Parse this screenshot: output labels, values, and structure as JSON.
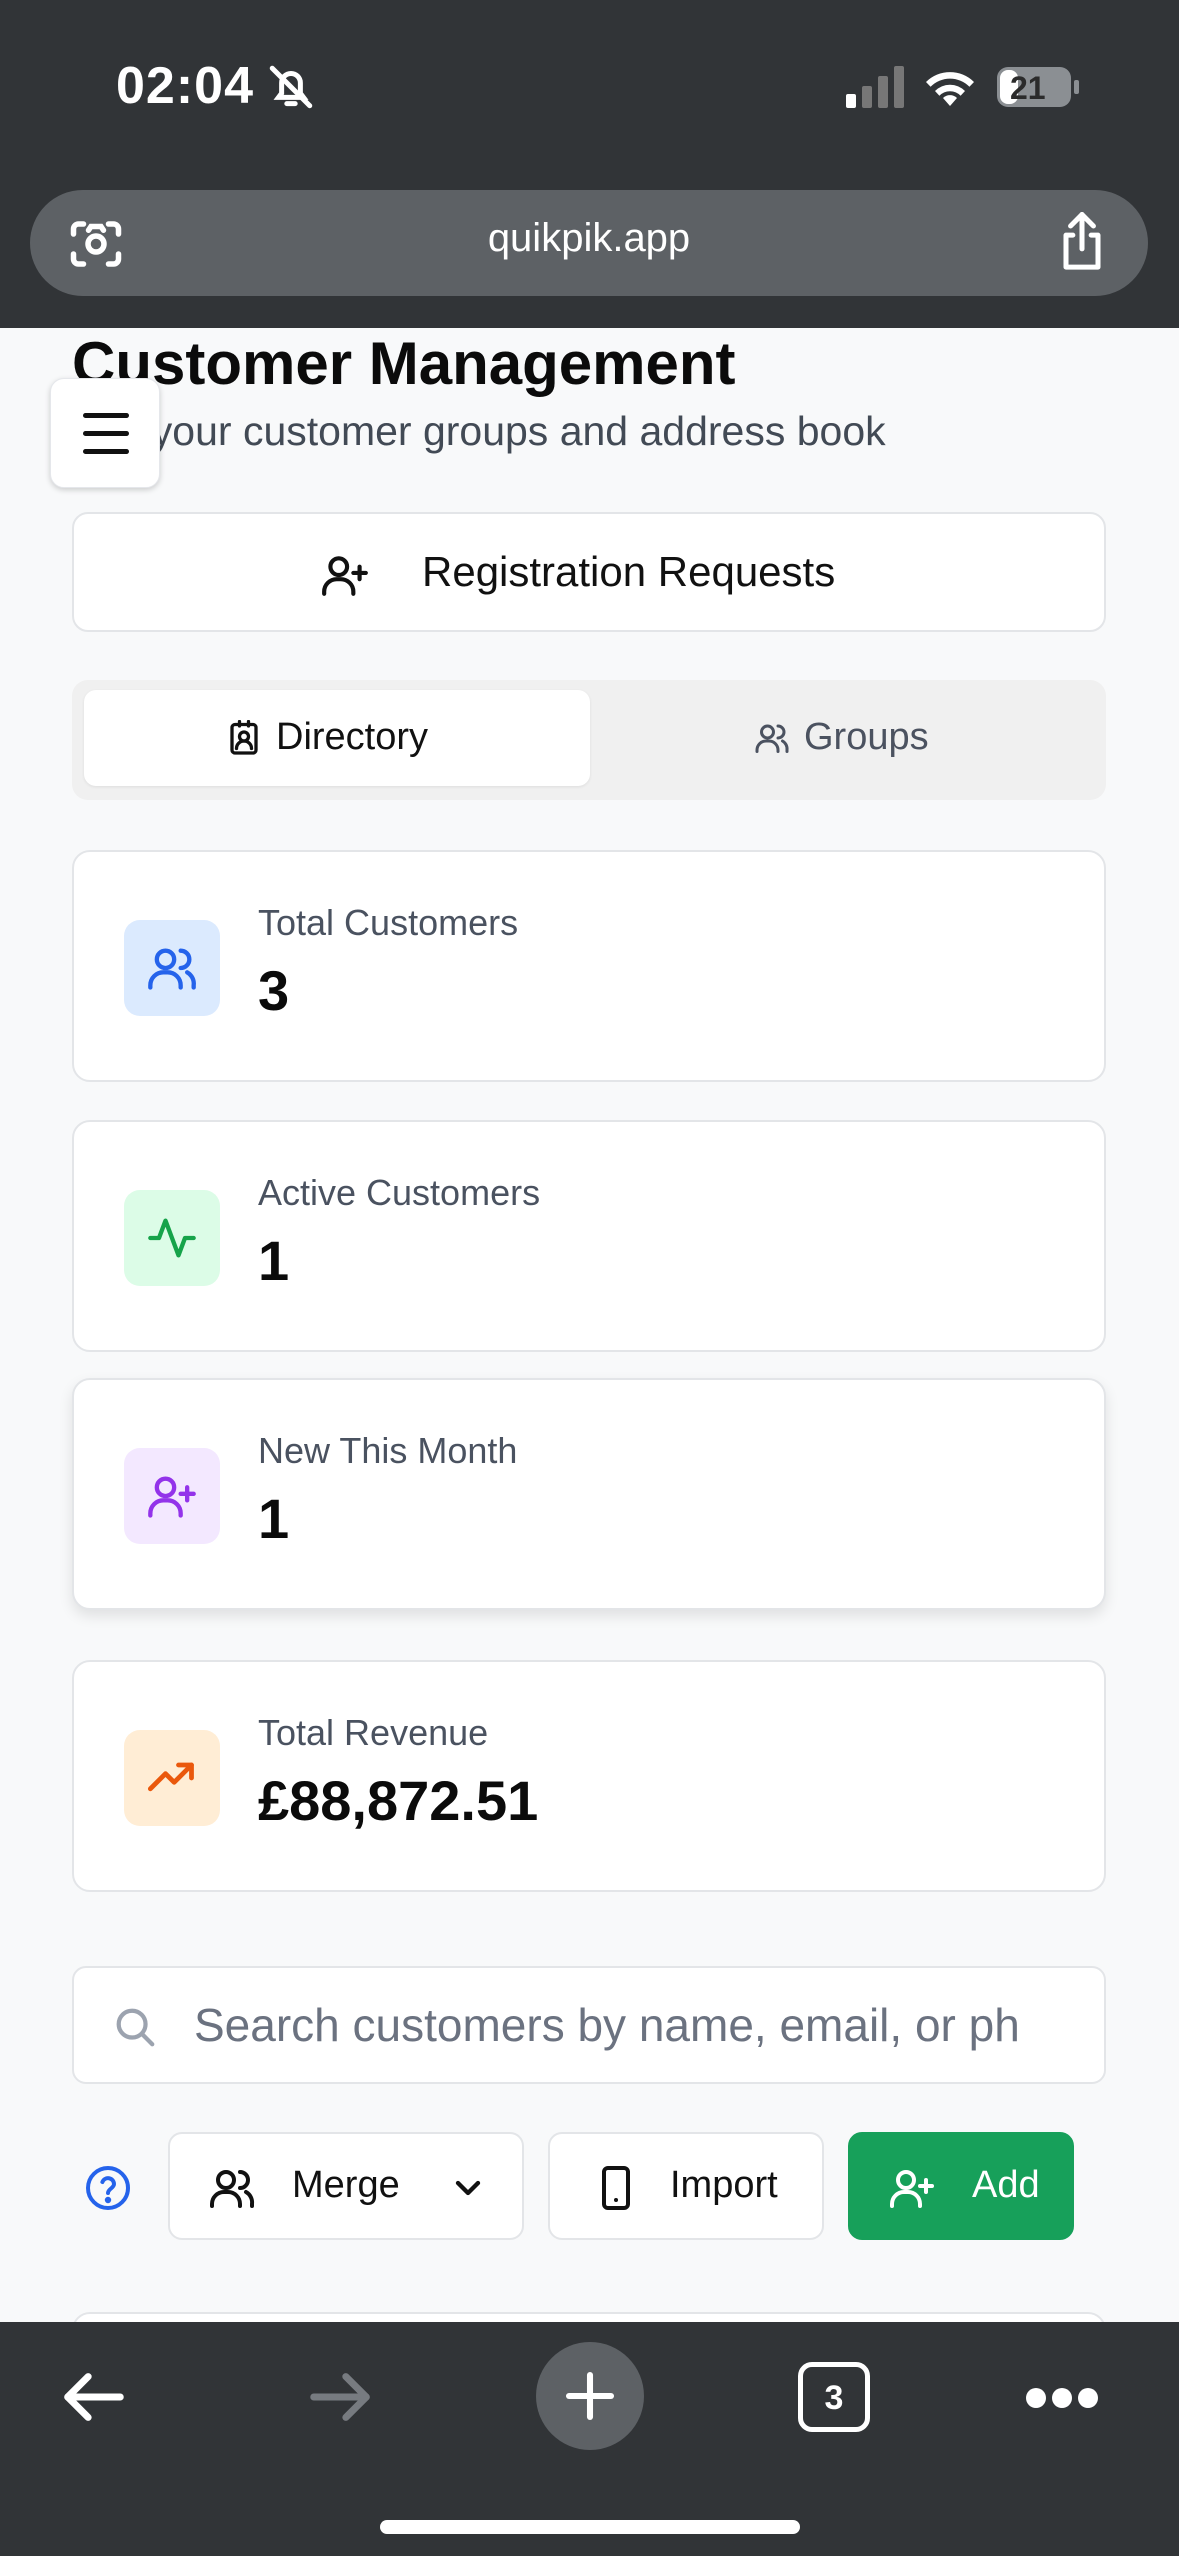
{
  "status_bar": {
    "time": "02:04",
    "battery": "21"
  },
  "browser": {
    "url": "quikpik.app",
    "tab_count": "3"
  },
  "header": {
    "title": "Customer Management",
    "subtitle": "age your customer groups and address book"
  },
  "registration": {
    "label": "Registration Requests"
  },
  "tabs": [
    {
      "label": "Directory",
      "active": true
    },
    {
      "label": "Groups",
      "active": false
    }
  ],
  "stats": [
    {
      "label": "Total Customers",
      "value": "3",
      "icon": "users-icon",
      "color": "#2563eb",
      "bg": "#dbeafe"
    },
    {
      "label": "Active Customers",
      "value": "1",
      "icon": "activity-icon",
      "color": "#16a34a",
      "bg": "#dcfce7"
    },
    {
      "label": "New This Month",
      "value": "1",
      "icon": "user-plus-icon",
      "color": "#9333ea",
      "bg": "#f3e8ff"
    },
    {
      "label": "Total Revenue",
      "value": "£88,872.51",
      "icon": "trending-up-icon",
      "color": "#ea580c",
      "bg": "#ffedd5"
    }
  ],
  "search": {
    "placeholder": "Search customers by name, email, or ph"
  },
  "actions": {
    "merge": "Merge",
    "import": "Import",
    "add": "Add"
  },
  "colors": {
    "accent_green": "#17a05a",
    "help_blue": "#2563eb",
    "chrome": "#313437"
  }
}
